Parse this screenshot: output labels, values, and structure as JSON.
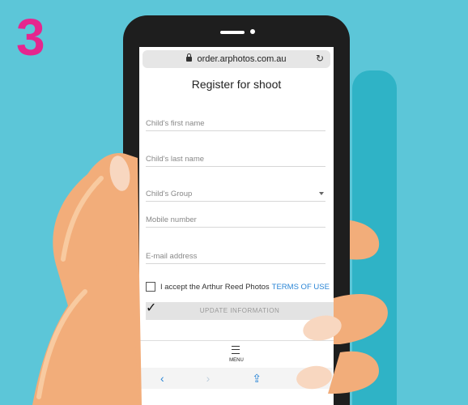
{
  "step": {
    "number": "3"
  },
  "browser": {
    "url": "order.arphotos.com.au",
    "toolbar": {
      "back": "‹",
      "forward": "›",
      "share": "⇪",
      "bookmarks": "⊔"
    }
  },
  "form": {
    "title": "Register for shoot",
    "fields": [
      {
        "placeholder": "Child's first name"
      },
      {
        "placeholder": "Child's last name"
      },
      {
        "placeholder": "Child's Group"
      },
      {
        "placeholder": "Mobile number"
      },
      {
        "placeholder": "E-mail address"
      }
    ],
    "terms": {
      "text": "I accept the Arthur Reed Photos",
      "link": "TERMS OF USE"
    },
    "update_button": "UPDATE INFORMATION"
  },
  "menu": {
    "label": "MENU"
  },
  "colors": {
    "background": "#5cc6d8",
    "step_number": "#e6268e",
    "link": "#2b86d6",
    "skin": "#f2ad7a"
  }
}
